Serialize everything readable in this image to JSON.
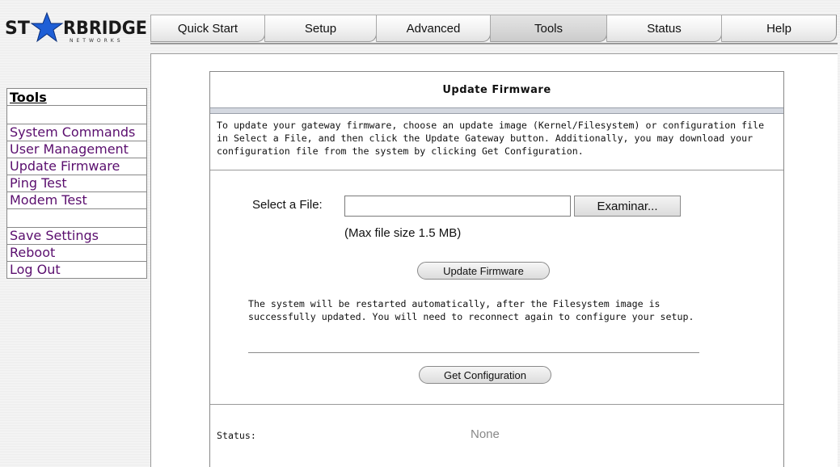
{
  "logo": {
    "text_left": "ST",
    "text_right": "RBRIDGE",
    "subtitle": "NETWORKS"
  },
  "nav": {
    "tabs": [
      {
        "label": "Quick Start",
        "active": false
      },
      {
        "label": "Setup",
        "active": false
      },
      {
        "label": "Advanced",
        "active": false
      },
      {
        "label": "Tools",
        "active": true
      },
      {
        "label": "Status",
        "active": false
      },
      {
        "label": "Help",
        "active": false
      }
    ]
  },
  "sidebar": {
    "title": "Tools",
    "items": [
      "System Commands",
      "User Management",
      "Update Firmware",
      "Ping Test",
      "Modem Test",
      "Save Settings",
      "Reboot",
      "Log Out"
    ]
  },
  "panel": {
    "title": "Update Firmware",
    "intro": "To update your gateway firmware, choose an update image (Kernel/Filesystem) or configuration file in Select a File, and then click the Update Gateway button. Additionally, you may download your configuration file from the system by clicking Get Configuration.",
    "file_label": "Select a File:",
    "file_value": "",
    "browse_label": "Examinar...",
    "max_size": "(Max file size 1.5 MB)",
    "update_button": "Update Firmware",
    "restart_note": "The system will be restarted automatically, after the Filesystem image is successfully updated. You will need to reconnect again to configure your setup.",
    "config_button": "Get Configuration",
    "status_label": "Status:",
    "status_value": "None"
  },
  "colors": {
    "star": "#1f5fd6",
    "link": "#5a0e6e",
    "status_value": "#888888"
  }
}
